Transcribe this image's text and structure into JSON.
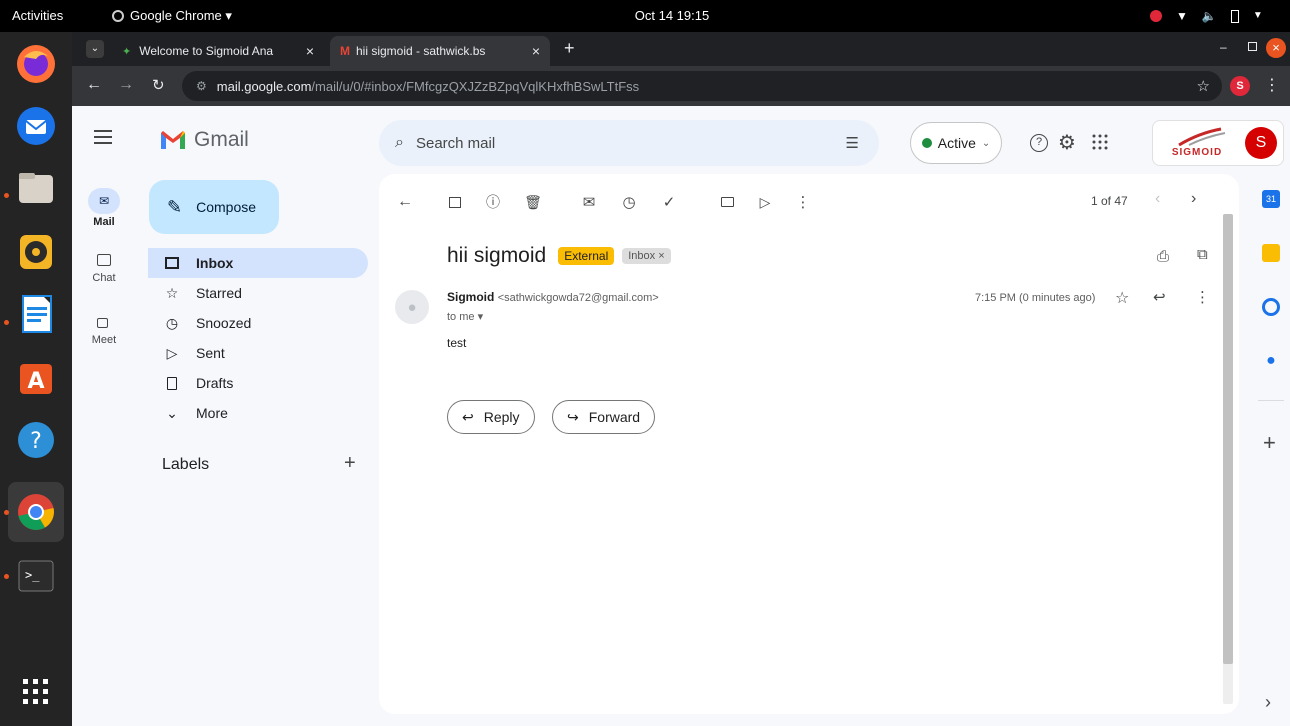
{
  "topbar": {
    "activities": "Activities",
    "app_name": "Google Chrome ▾",
    "datetime": "Oct 14  19:15"
  },
  "browser": {
    "tabs": [
      {
        "title": "Welcome to Sigmoid Ana",
        "close": "×"
      },
      {
        "title": "hii sigmoid - sathwick.bs",
        "close": "×"
      }
    ],
    "new_tab": "+",
    "url_host": "mail.google.com",
    "url_path": "/mail/u/0/#inbox/FMfcgzQXJZzBZpqVqlKHxfhBSwLTtFss",
    "profile_initial": "S"
  },
  "gmail": {
    "logo_text": "Gmail",
    "search_placeholder": "Search mail",
    "status": "Active",
    "account_initial": "S",
    "org_logo_text": "SIGMOID",
    "compose": "Compose",
    "rail": [
      {
        "label": "Mail"
      },
      {
        "label": "Chat"
      },
      {
        "label": "Meet"
      }
    ],
    "nav": [
      {
        "label": "Inbox",
        "icon": "inbox-icon"
      },
      {
        "label": "Starred",
        "icon": "star-icon"
      },
      {
        "label": "Snoozed",
        "icon": "clock-icon"
      },
      {
        "label": "Sent",
        "icon": "send-icon"
      },
      {
        "label": "Drafts",
        "icon": "draft-icon"
      },
      {
        "label": "More",
        "icon": "chevron-down-icon"
      }
    ],
    "labels_heading": "Labels",
    "labels_add": "+",
    "pagination": "1 of 47",
    "message": {
      "subject": "hii sigmoid",
      "badge_external": "External",
      "badge_inbox": "Inbox ×",
      "sender_name": "Sigmoid",
      "sender_email": "<sathwickgowda72@gmail.com>",
      "to": "to me ▾",
      "time": "7:15 PM (0 minutes ago)",
      "body": "test"
    },
    "actions": {
      "reply": "Reply",
      "forward": "Forward"
    },
    "side_panel_add": "+",
    "side_panel_toggle": "›"
  },
  "colors": {
    "accent_blue": "#c2e7ff",
    "active_nav": "#d3e3fd",
    "external_badge": "#fbbc04",
    "status_green": "#1e8e3e"
  }
}
